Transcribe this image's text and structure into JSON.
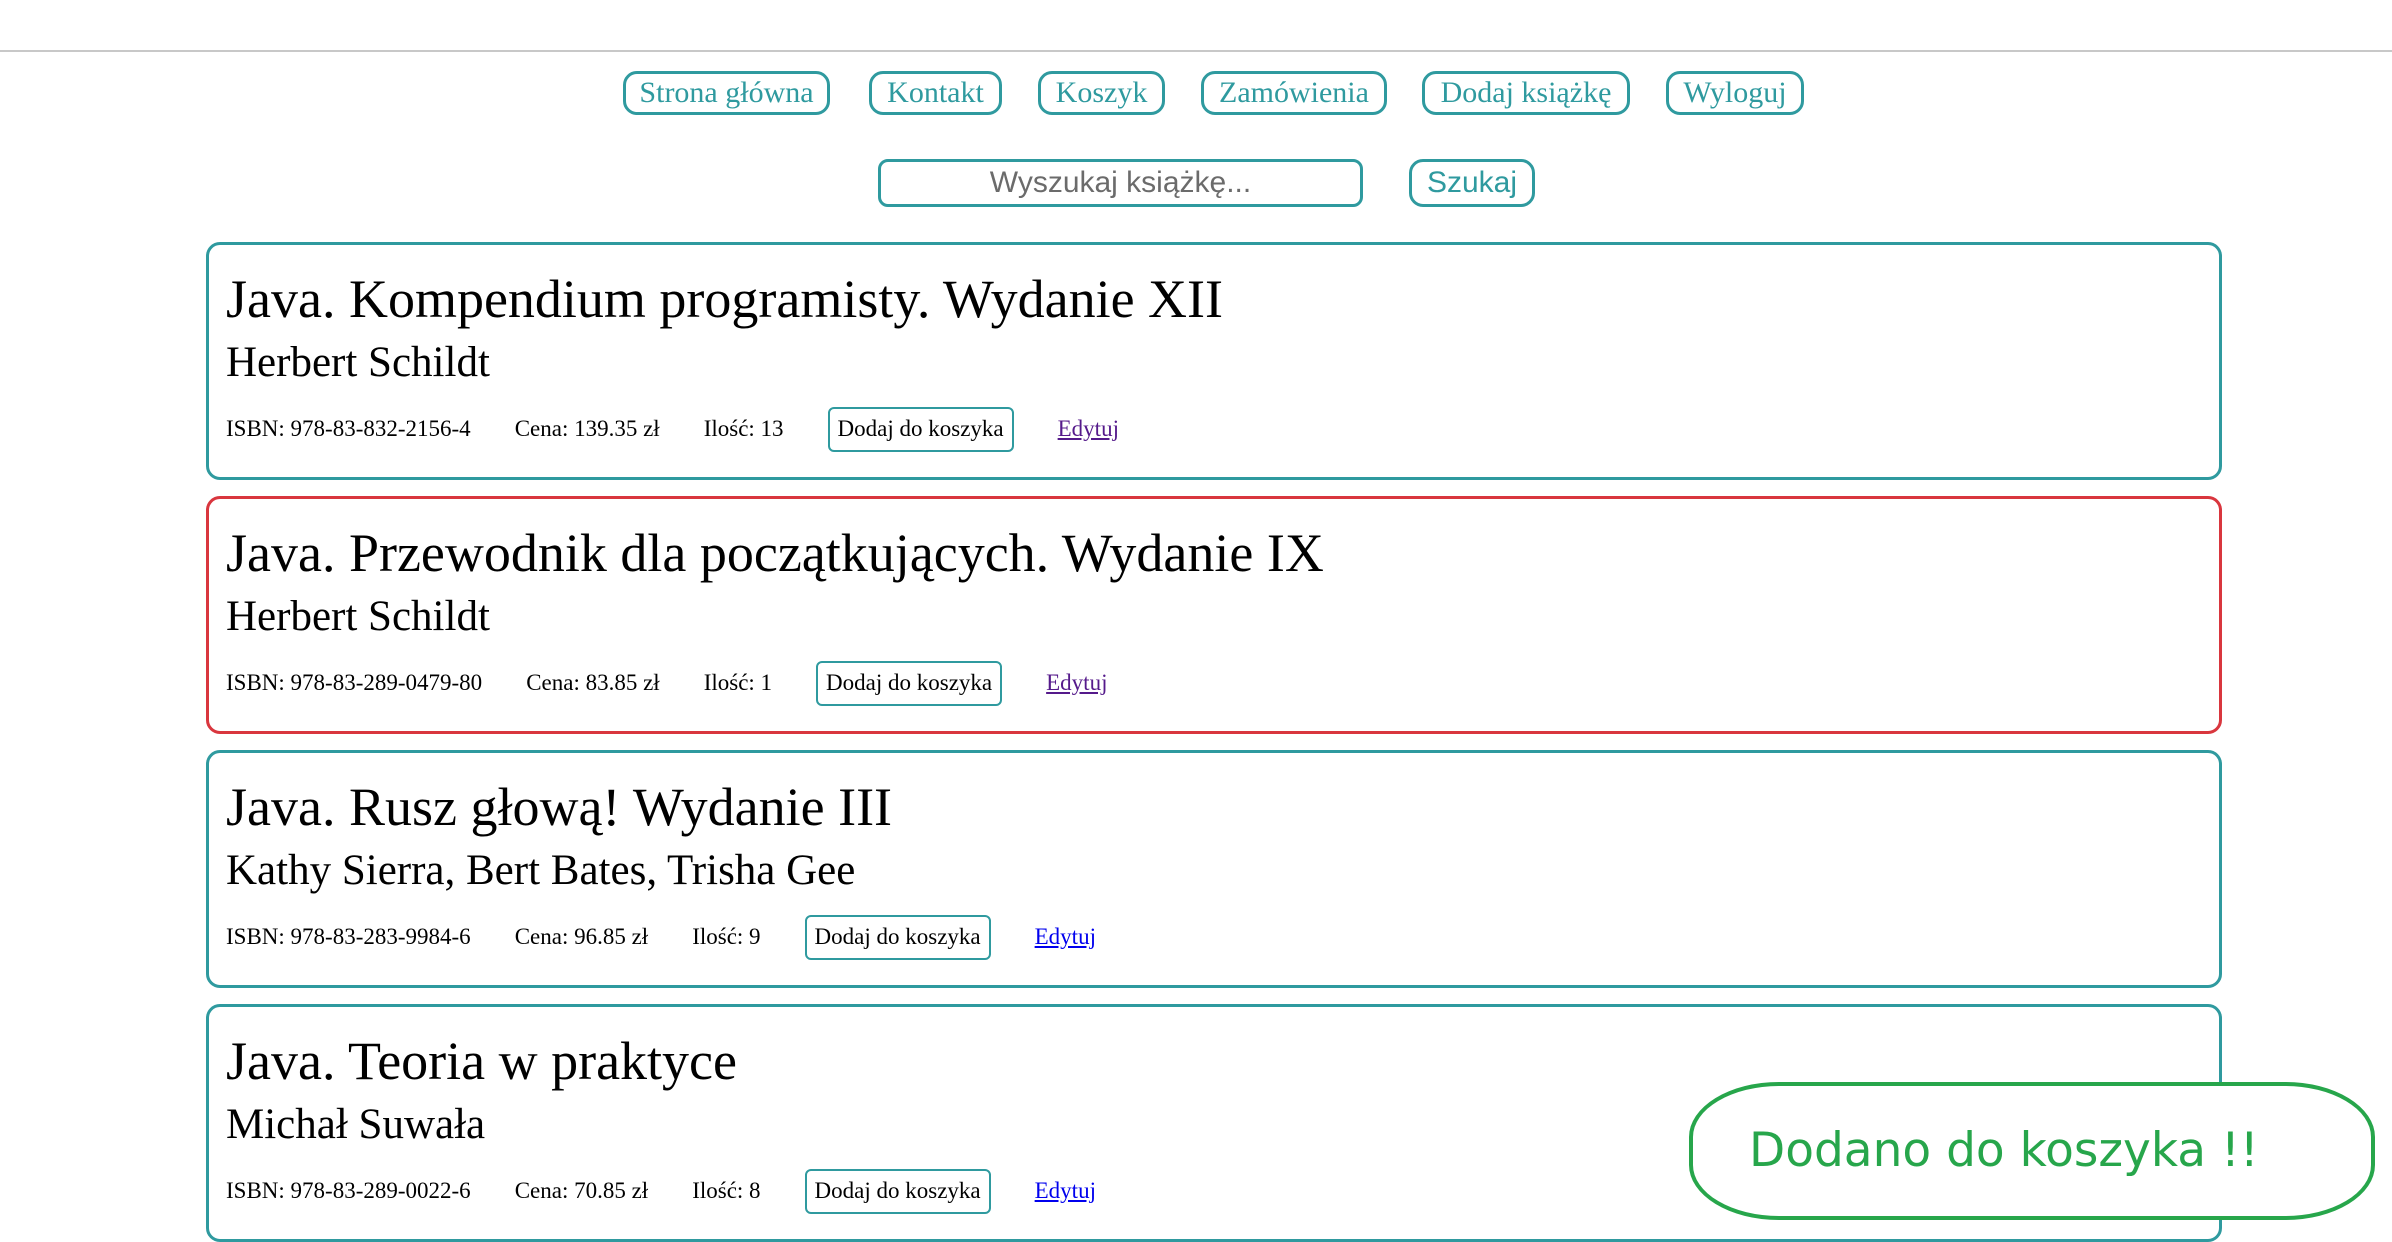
{
  "nav": {
    "items": [
      {
        "label": "Strona główna"
      },
      {
        "label": "Kontakt"
      },
      {
        "label": "Koszyk"
      },
      {
        "label": "Zamówienia"
      },
      {
        "label": "Dodaj książkę"
      },
      {
        "label": "Wyloguj"
      }
    ]
  },
  "search": {
    "placeholder": "Wyszukaj książkę...",
    "value": "",
    "button_label": "Szukaj"
  },
  "books": [
    {
      "title": "Java. Kompendium programisty. Wydanie XII",
      "author": "Herbert Schildt",
      "isbn": "ISBN: 978-83-832-2156-4",
      "price": "Cena: 139.35 zł",
      "quantity": "Ilość: 13",
      "add_label": "Dodaj do koszyka",
      "edit_label": "Edytuj"
    },
    {
      "title": "Java. Przewodnik dla początkujących. Wydanie IX",
      "author": "Herbert Schildt",
      "isbn": "ISBN: 978-83-289-0479-80",
      "price": "Cena: 83.85 zł",
      "quantity": "Ilość: 1",
      "add_label": "Dodaj do koszyka",
      "edit_label": "Edytuj"
    },
    {
      "title": "Java. Rusz głową! Wydanie III",
      "author": "Kathy Sierra, Bert Bates, Trisha Gee",
      "isbn": "ISBN: 978-83-283-9984-6",
      "price": "Cena: 96.85 zł",
      "quantity": "Ilość: 9",
      "add_label": "Dodaj do koszyka",
      "edit_label": "Edytuj"
    },
    {
      "title": "Java. Teoria w praktyce",
      "author": "Michał Suwała",
      "isbn": "ISBN: 978-83-289-0022-6",
      "price": "Cena: 70.85 zł",
      "quantity": "Ilość: 8",
      "add_label": "Dodaj do koszyka",
      "edit_label": "Edytuj"
    }
  ],
  "toast": {
    "message": "Dodano do koszyka !!"
  },
  "colors": {
    "accent": "#2f9a9f",
    "highlight_border": "#d9363e",
    "toast_green": "#27a64b",
    "link_visited": "#551a8b",
    "link_unvisited": "#0000ee"
  }
}
